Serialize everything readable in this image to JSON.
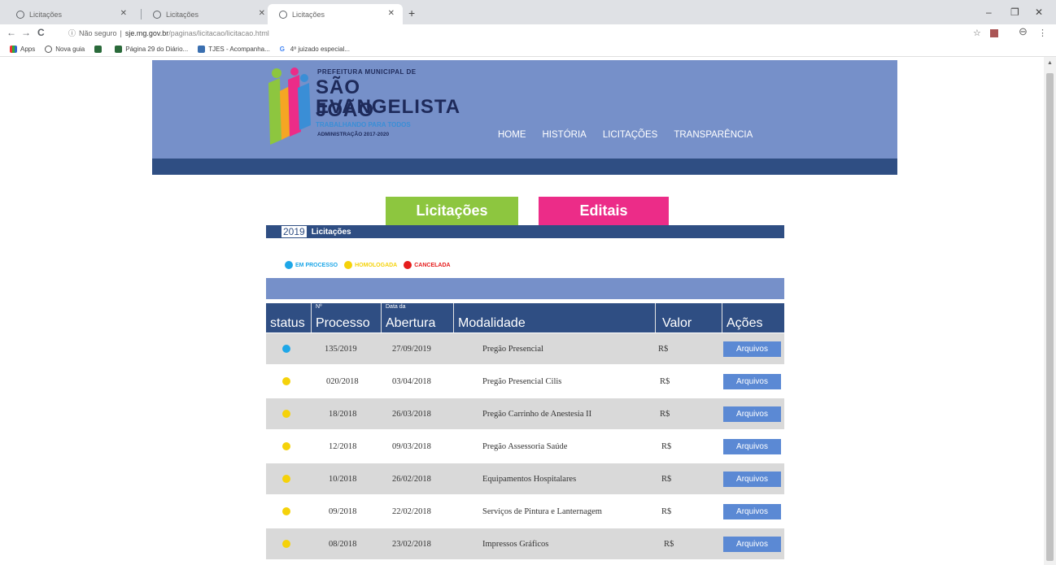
{
  "browser": {
    "tabs": [
      {
        "title": "Licitações"
      },
      {
        "title": "Licitações"
      },
      {
        "title": "Licitações"
      }
    ],
    "not_secure": "Não seguro",
    "url_host": "sje.mg.gov.br",
    "url_path": "/paginas/licitacao/licitacao.html",
    "bookmarks": [
      "Apps",
      "Nova guia",
      "",
      "Página 29 do Diário...",
      "TJES - Acompanha...",
      "4º juizado especial..."
    ]
  },
  "site": {
    "logo": {
      "line1": "PREFEITURA MUNICIPAL DE",
      "line2": "SÃO JOÃO",
      "line3": "EVANGELISTA",
      "line4": "TRABALHANDO PARA TODOS",
      "line5": "ADMINISTRAÇÃO 2017-2020"
    },
    "nav": [
      "HOME",
      "HISTÓRIA",
      "LICITAÇÕES",
      "TRANSPARÊNCIA"
    ]
  },
  "tabs": {
    "licitacoes": "Licitações",
    "editais": "Editais"
  },
  "yearbar": {
    "year": "2019",
    "label": "Licitações"
  },
  "legend": [
    {
      "label": "EM PROCESSO",
      "color": "#1ea7e8"
    },
    {
      "label": "HOMOLOGADA",
      "color": "#f5d20a"
    },
    {
      "label": "CANCELADA",
      "color": "#e51c1c"
    }
  ],
  "table": {
    "headers": [
      {
        "small": "",
        "big": "status"
      },
      {
        "small": "Nº",
        "big": "Processo"
      },
      {
        "small": "Data da",
        "big": "Abertura"
      },
      {
        "small": "",
        "big": "Modalidade"
      },
      {
        "small": "",
        "big": "Valor"
      },
      {
        "small": "",
        "big": "Ações"
      }
    ],
    "rows": [
      {
        "status": "blue",
        "processo": "135/2019",
        "data": "27/09/2019",
        "modalidade": "Pregão Presencial",
        "valor": "R$",
        "acao": "Arquivos"
      },
      {
        "status": "yellow",
        "processo": "020/2018",
        "data": "03/04/2018",
        "modalidade": "Pregão Presencial Cilis",
        "valor": "R$",
        "acao": "Arquivos"
      },
      {
        "status": "yellow",
        "processo": "18/2018",
        "data": "26/03/2018",
        "modalidade": "Pregão Carrinho de Anestesia II",
        "valor": "R$",
        "acao": "Arquivos"
      },
      {
        "status": "yellow",
        "processo": "12/2018",
        "data": "09/03/2018",
        "modalidade": "Pregão Assessoria Saúde",
        "valor": "R$",
        "acao": "Arquivos"
      },
      {
        "status": "yellow",
        "processo": "10/2018",
        "data": "26/02/2018",
        "modalidade": "Equipamentos Hospitalares",
        "valor": "R$",
        "acao": "Arquivos"
      },
      {
        "status": "yellow",
        "processo": "09/2018",
        "data": "22/02/2018",
        "modalidade": "Serviços de Pintura e Lanternagem",
        "valor": "R$",
        "acao": "Arquivos"
      },
      {
        "status": "yellow",
        "processo": "08/2018",
        "data": "23/02/2018",
        "modalidade": "Impressos Gráficos",
        "valor": "R$",
        "acao": "Arquivos"
      }
    ]
  },
  "colors": {
    "header": "#7690c9",
    "dark": "#2f4e83",
    "green": "#8dc63f",
    "pink": "#ec2c88",
    "button": "#5b89d4",
    "status_blue": "#1ea7e8",
    "status_yellow": "#f5d20a"
  }
}
